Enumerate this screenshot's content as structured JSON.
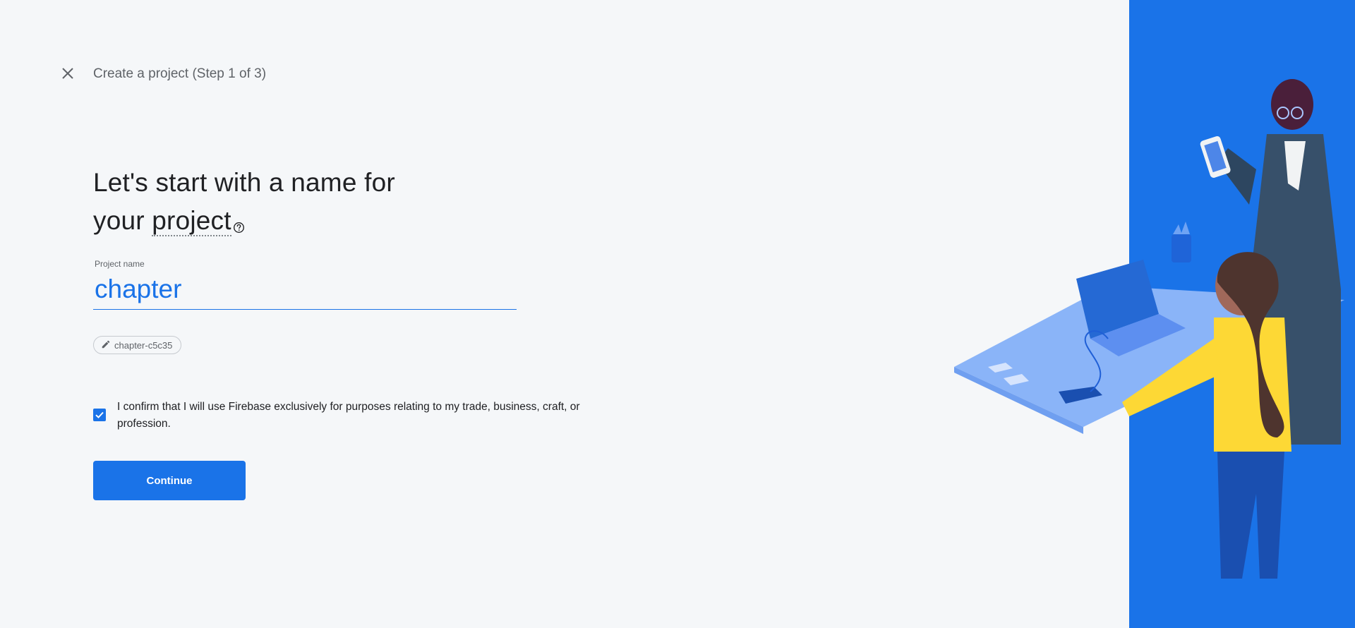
{
  "header": {
    "title": "Create a project (Step 1 of 3)",
    "close_icon": "close-icon"
  },
  "main": {
    "headline_line1": "Let's start with a name for",
    "headline_word_your": "your",
    "headline_term": "project",
    "help_icon": "help-circle-icon",
    "project_name_label": "Project name",
    "project_name_value": "chapter",
    "project_id": "chapter-c5c35",
    "edit_icon": "pencil-icon",
    "confirm_checked": true,
    "confirm_text": "I confirm that I will use Firebase exclusively for purposes relating to my trade, business, craft, or profession.",
    "continue_label": "Continue"
  },
  "colors": {
    "accent": "#1a73e8",
    "background": "#f5f7f9",
    "text_primary": "#202124",
    "text_secondary": "#5f6368"
  }
}
